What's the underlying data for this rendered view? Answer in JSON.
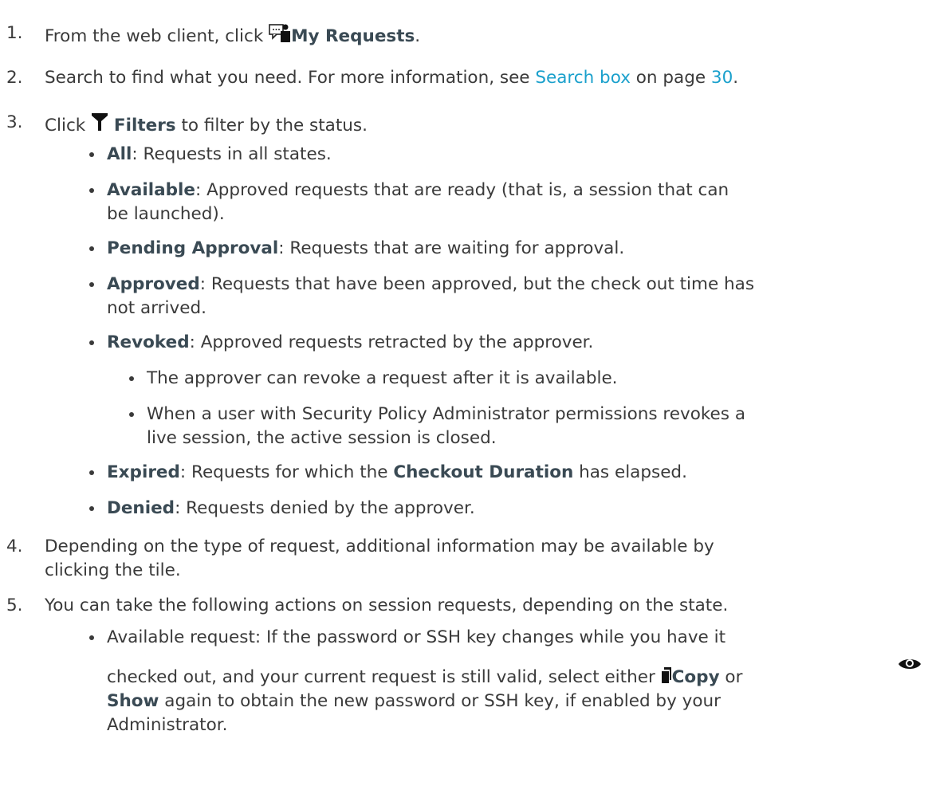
{
  "steps": [
    {
      "num": "1.",
      "pre": "From the web client, click ",
      "icon": "my-requests-icon",
      "bold": "My Requests",
      "post": "."
    },
    {
      "num": "2.",
      "pre": "Search to find what you need. For more information, see ",
      "link": "Search box",
      "mid": " on page ",
      "page_link": "30",
      "post": "."
    },
    {
      "num": "3.",
      "pre": "Click ",
      "icon": "filter-icon",
      "bold": "Filters",
      "post": " to filter by the status."
    },
    {
      "num": "4.",
      "lines": [
        "Depending on the type of request, additional information may be available by",
        "clicking the tile."
      ]
    },
    {
      "num": "5.",
      "text": "You can take the following actions on session requests, depending on the state."
    }
  ],
  "filters": [
    {
      "label": "All",
      "desc": ": Requests in all states."
    },
    {
      "label": "Available",
      "desc": ": Approved requests that are ready (that is, a session that can",
      "desc2": "be launched)."
    },
    {
      "label": "Pending Approval",
      "desc": ": Requests that are waiting for approval."
    },
    {
      "label": "Approved",
      "desc": ": Requests that have been approved, but the check out time has",
      "desc2": "not arrived."
    },
    {
      "label": "Revoked",
      "desc": ": Approved requests retracted by the approver."
    },
    {
      "label": "Expired",
      "desc": ": Requests for which the ",
      "bold2": "Checkout Duration",
      "desc_end": " has elapsed."
    },
    {
      "label": "Denied",
      "desc": ": Requests denied by the approver."
    }
  ],
  "revoked_notes": [
    {
      "text": "The approver can revoke a request after it is available."
    },
    {
      "text": "When a user with Security Policy Administrator permissions revokes a",
      "text2": "live session, the active session is closed."
    }
  ],
  "actions": {
    "line1": "Available request: If the password or SSH key changes while you have it",
    "line2_pre": "checked out, and your current request is still valid, select either ",
    "copy_icon": "copy-icon",
    "copy_label": "Copy",
    "or_text": " or ",
    "show_icon": "eye-icon",
    "show_label": "Show",
    "line3_post": " again to obtain the new password or SSH key, if enabled by your",
    "line4": "Administrator."
  },
  "colors": {
    "text": "#3a3a3a",
    "bold": "#3a4a54",
    "link": "#1aa0cc"
  }
}
